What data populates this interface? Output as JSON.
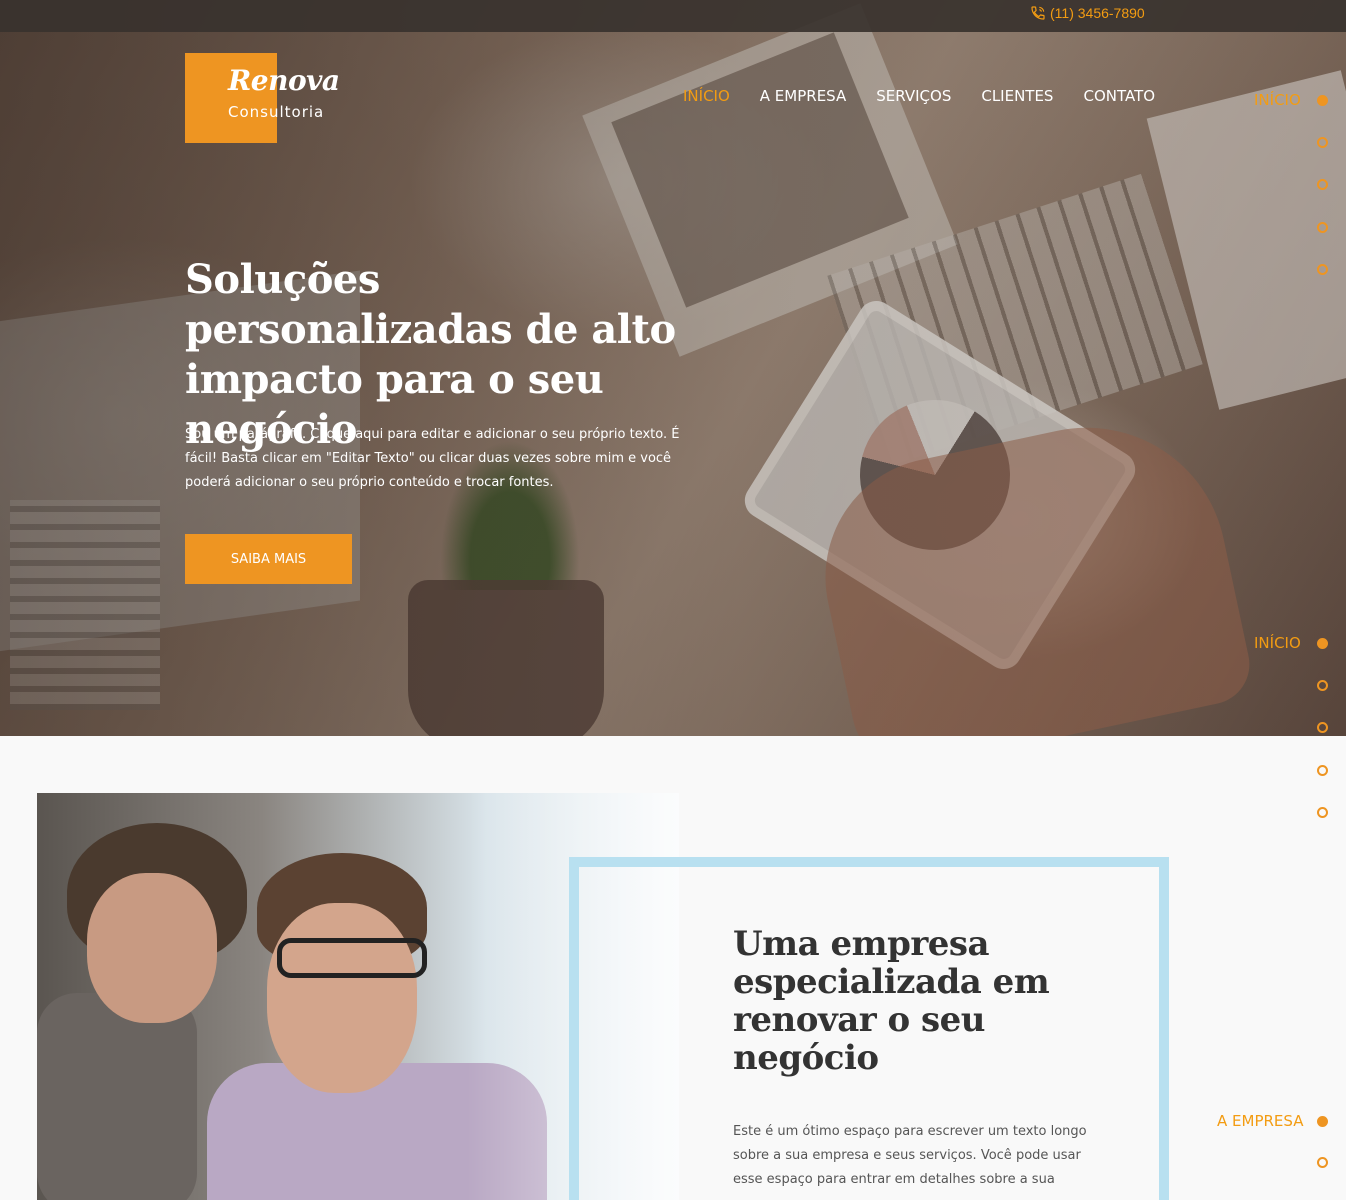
{
  "topbar": {
    "phone": "(11) 3456-7890"
  },
  "brand": {
    "name": "Renova",
    "tagline": "Consultoria"
  },
  "nav": {
    "items": [
      {
        "label": "INÍCIO",
        "active": true
      },
      {
        "label": "A EMPRESA"
      },
      {
        "label": "SERVIÇOS"
      },
      {
        "label": "CLIENTES"
      },
      {
        "label": "CONTATO"
      }
    ]
  },
  "hero": {
    "title": "Soluções personalizadas de alto impacto para o seu negócio",
    "paragraph": "Sou um parágrafo. Clique aqui para editar e adicionar o seu próprio texto. É fácil! Basta clicar em \"Editar Texto\" ou clicar duas vezes sobre mim e você poderá adicionar o seu próprio conteúdo e trocar fontes.",
    "button": "SAIBA MAIS"
  },
  "side_nav": {
    "active_label_1": "INÍCIO",
    "active_label_2": "INÍCIO",
    "active_label_3": "A EMPRESA"
  },
  "about": {
    "title": "Uma empresa especializada em renovar o seu negócio",
    "paragraph": "Este é um ótimo espaço para escrever um texto longo sobre a sua empresa e seus serviços. Você pode usar esse espaço para entrar em detalhes sobre a sua"
  },
  "colors": {
    "accent": "#ee9522",
    "frame": "#b8e0f0",
    "topbar": "#38322e"
  }
}
